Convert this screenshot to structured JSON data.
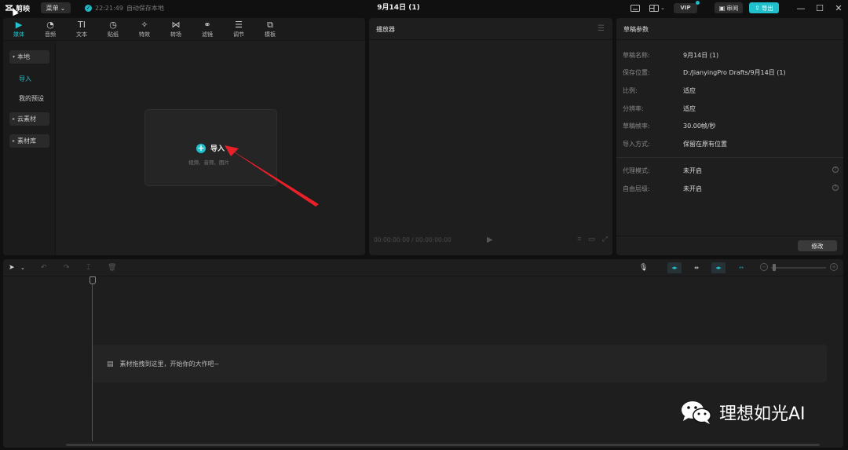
{
  "titlebar": {
    "app_name": "剪映",
    "menu_label": "菜单",
    "save_time": "22:21:49",
    "save_status": "自动保存本地",
    "project_title": "9月14日 (1)",
    "vip_label": "VIP",
    "review_label": "审阅",
    "export_label": "导出"
  },
  "media": {
    "tabs": [
      {
        "icon": "media-icon",
        "label": "媒体"
      },
      {
        "icon": "audio-icon",
        "label": "音频"
      },
      {
        "icon": "text-icon",
        "label": "文本",
        "glyph": "TI"
      },
      {
        "icon": "sticker-icon",
        "label": "贴纸"
      },
      {
        "icon": "effects-icon",
        "label": "特效"
      },
      {
        "icon": "transition-icon",
        "label": "转场"
      },
      {
        "icon": "filter-icon",
        "label": "滤镜"
      },
      {
        "icon": "adjust-icon",
        "label": "调节"
      },
      {
        "icon": "template-icon",
        "label": "模板"
      }
    ],
    "sidebar": {
      "local": "本地",
      "import": "导入",
      "my_presets": "我的预设",
      "cloud": "云素材",
      "library": "素材库"
    },
    "import_label": "导入",
    "import_sub": "视频、音频、图片"
  },
  "player": {
    "title": "播放器",
    "time_display": "00:00:00:00 / 00:00:00:00"
  },
  "params": {
    "title": "草稿参数",
    "rows": [
      {
        "key": "草稿名称:",
        "value": "9月14日 (1)"
      },
      {
        "key": "保存位置:",
        "value": "D:/JianyingPro Drafts/9月14日 (1)"
      },
      {
        "key": "比例:",
        "value": "适应"
      },
      {
        "key": "分辨率:",
        "value": "适应"
      },
      {
        "key": "草稿帧率:",
        "value": "30.00帧/秒"
      },
      {
        "key": "导入方式:",
        "value": "保留在原有位置"
      }
    ],
    "extra_rows": [
      {
        "key": "代理模式:",
        "value": "未开启"
      },
      {
        "key": "自由层级:",
        "value": "未开启"
      }
    ],
    "modify_label": "修改"
  },
  "timeline": {
    "drop_hint": "素材拖拽到这里，开始你的大作吧~"
  },
  "watermark": {
    "text": "理想如光AI"
  },
  "colors": {
    "accent": "#1fbfcc",
    "panel": "#1e1e1e",
    "background": "#101010"
  }
}
